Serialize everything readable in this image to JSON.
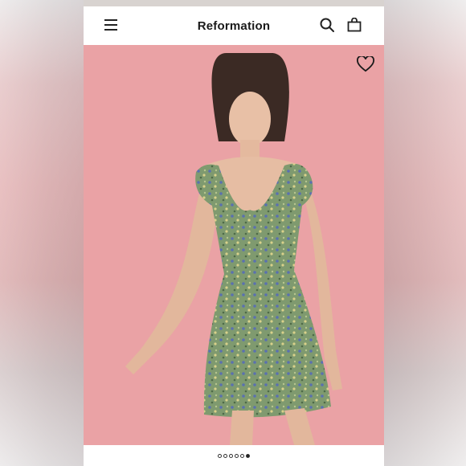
{
  "header": {
    "brand": "Reformation",
    "icons": {
      "menu": "menu-icon",
      "search": "search-icon",
      "bag": "shopping-bag-icon",
      "favorite": "heart-icon"
    }
  },
  "product_image": {
    "subject": "model-in-green-floral-mini-dress",
    "background_color": "#eaa2a5"
  },
  "carousel": {
    "total": 6,
    "active_index": 6
  }
}
